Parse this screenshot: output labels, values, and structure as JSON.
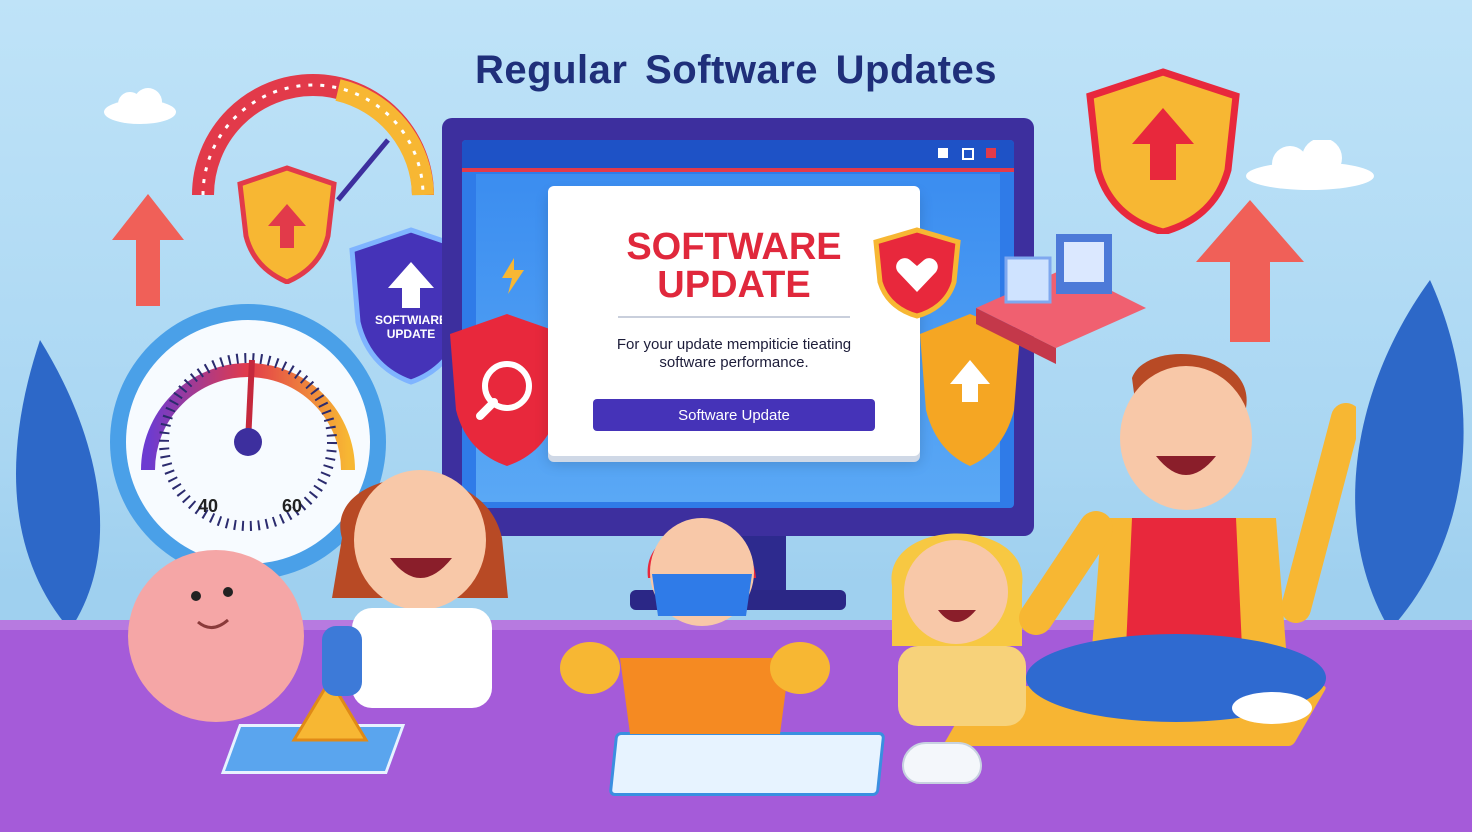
{
  "title": "Regular Software  Updates",
  "screen": {
    "dialog_title_line1": "SOFTWARE",
    "dialog_title_line2": "UPDATE",
    "dialog_body_line1": "For your update mempiticie tieating",
    "dialog_body_line2": "software performance.",
    "button_label": "Software Update"
  },
  "badge": {
    "line1": "SOFTWIARE",
    "line2": "UPDATE"
  },
  "gauge": {
    "label_left": "40",
    "label_right": "60"
  },
  "icons": [
    "shield-arrow-icon",
    "speedometer-icon",
    "arrow-up-icon",
    "heart-shield-icon",
    "wrench-shield-icon",
    "cloud-icon",
    "lightning-icon",
    "keyboard-icon",
    "mouse-icon"
  ],
  "colors": {
    "accent_red": "#e0283c",
    "accent_blue": "#4533b8",
    "shield_yellow": "#f7b733",
    "floor_purple": "#a55bd9"
  }
}
